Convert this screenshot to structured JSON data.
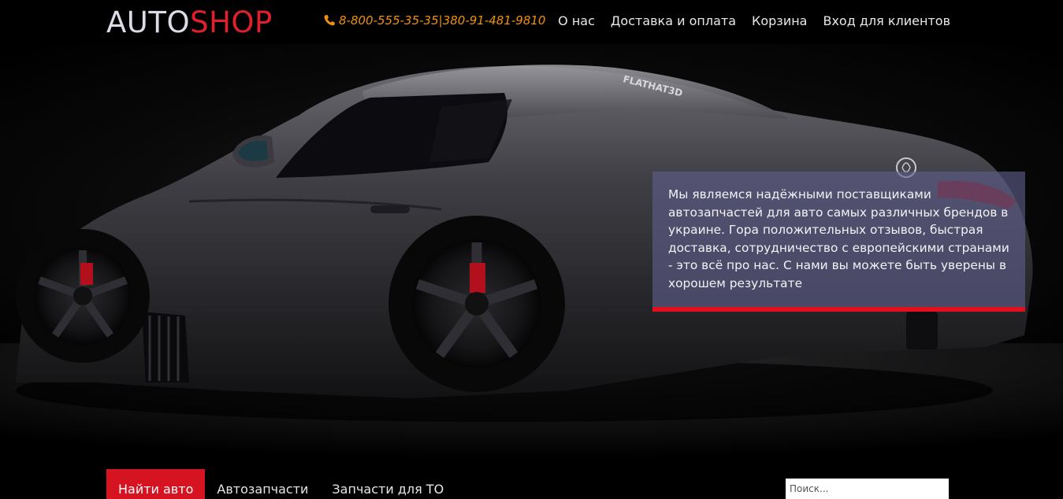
{
  "header": {
    "logo_part1": "AUTO",
    "logo_part2": "SHOP",
    "phone_1": "8-800-555-35-35",
    "phone_separator": "|",
    "phone_2": "380-91-481-9810",
    "phone_icon": "phone-icon",
    "nav": [
      {
        "label": "О нас"
      },
      {
        "label": "Доставка и оплата"
      },
      {
        "label": "Корзина"
      },
      {
        "label": "Вход для клиентов"
      }
    ]
  },
  "hero": {
    "rear_window_text": "FLATHAT3D",
    "info_text": "Мы являемся надёжными поставщиками автозапчастей для авто самых различных брендов в украине. Гора положительных отзывов, быстрая доставка, сотрудничество с европейскими странами - это всё про нас. С нами вы можете быть уверены в хорошем результате"
  },
  "categories": [
    {
      "label": "Найти авто"
    },
    {
      "label": "Автозапчасти"
    },
    {
      "label": "Запчасти для ТО"
    }
  ],
  "search": {
    "placeholder": "Поиск..."
  },
  "colors": {
    "accent_red": "#e0202c",
    "phone_orange": "#f0910f",
    "info_panel": "#60608c",
    "active_tab": "#d61321"
  }
}
